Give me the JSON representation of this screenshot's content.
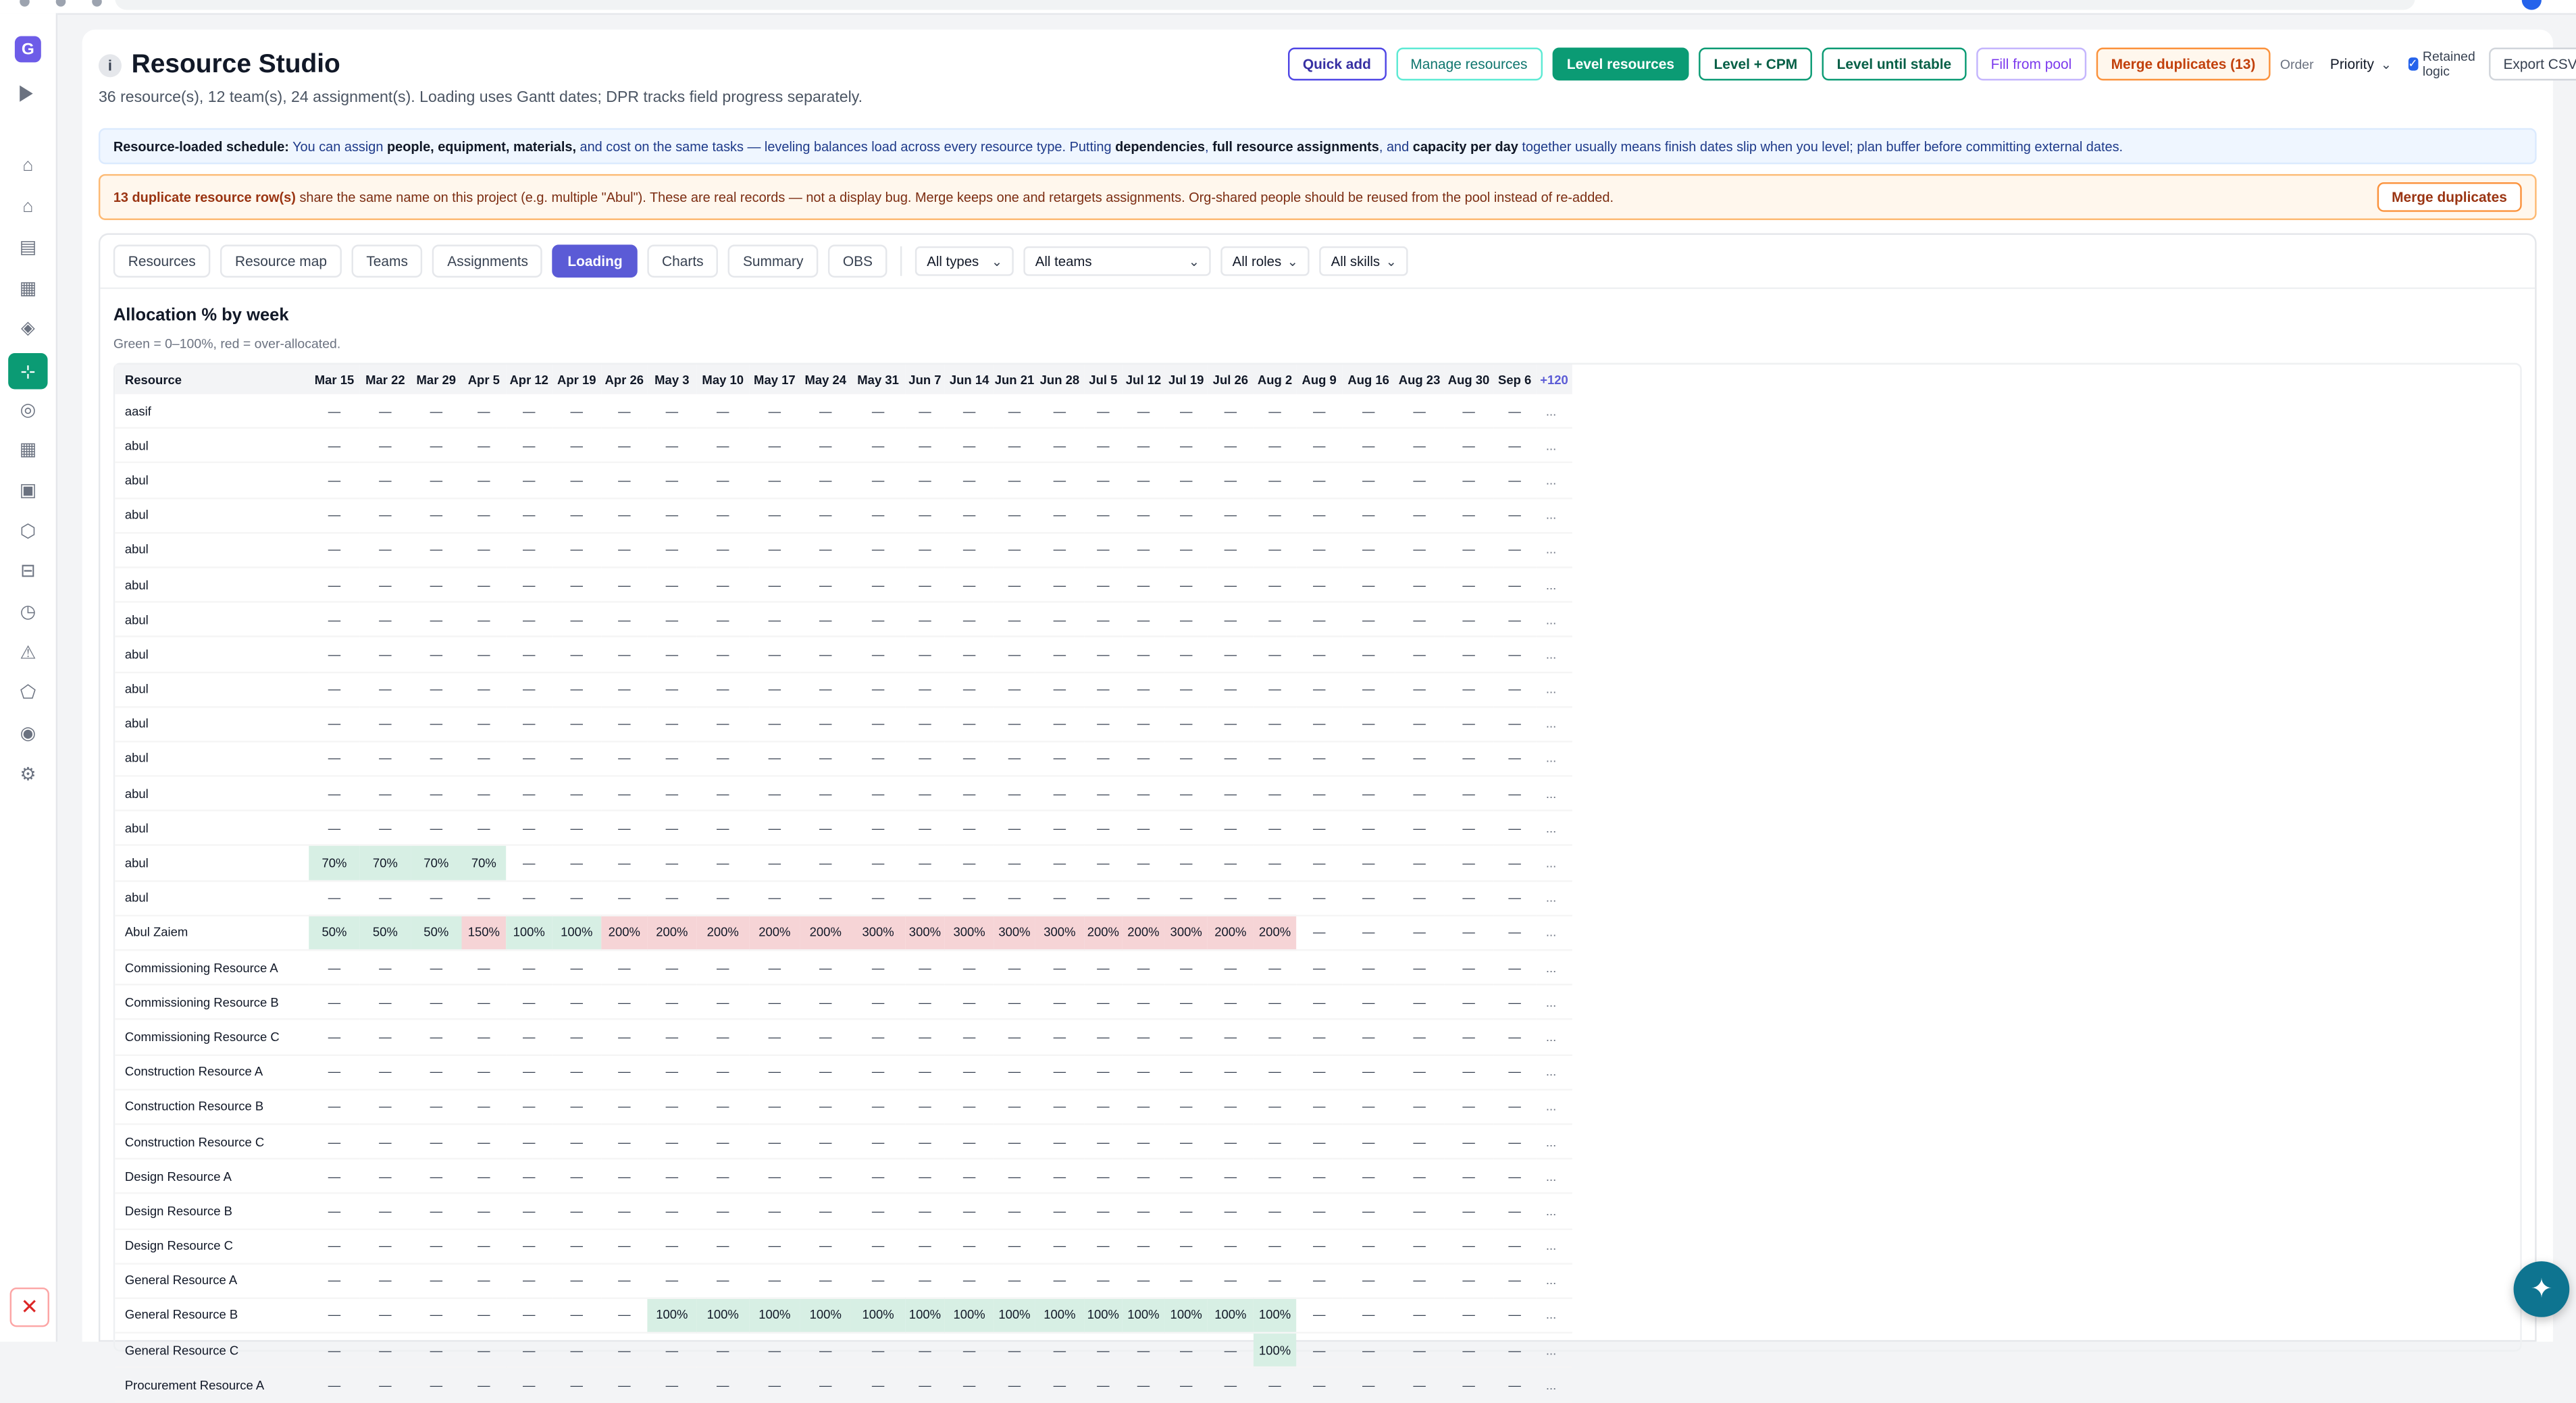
{
  "app": {
    "title": "Resource Studio",
    "info_glyph": "i",
    "subtitle": "36 resource(s), 12 team(s), 24 assignment(s). Loading uses Gantt dates; DPR tracks field progress separately.",
    "logo_letter": "G"
  },
  "toolbar": {
    "quick_add": "Quick add",
    "manage_resources": "Manage resources",
    "level_resources": "Level resources",
    "level_cpm": "Level + CPM",
    "level_until_stable": "Level until stable",
    "fill_from_pool": "Fill from pool",
    "merge_duplicates": "Merge duplicates (13)",
    "order_label": "Order",
    "order_value": "Priority",
    "retained_logic": "Retained logic",
    "retained_logic_checked": true,
    "export_csv": "Export CSV"
  },
  "banner_info": {
    "lead": "Resource-loaded schedule:",
    "t1": " You can assign ",
    "b1": "people, equipment, materials,",
    "t2": " and cost on the same tasks — leveling balances load across every resource type. Putting ",
    "b2": "dependencies",
    "t3": ", ",
    "b3": "full resource assignments",
    "t4": ", and ",
    "b4": "capacity per day",
    "t5": " together usually means finish dates slip when you level; plan buffer before committing external dates."
  },
  "banner_dup": {
    "lead": "13 duplicate resource row(s)",
    "text": " share the same name on this project (e.g. multiple \"Abul\"). These are real records — not a display bug. Merge keeps one and retargets assignments. Org-shared people should be reused from the pool instead of re-added.",
    "button": "Merge duplicates"
  },
  "tabs": [
    "Resources",
    "Resource map",
    "Teams",
    "Assignments",
    "Loading",
    "Charts",
    "Summary",
    "OBS"
  ],
  "active_tab": "Loading",
  "filters": {
    "types": "All types",
    "teams": "All teams",
    "roles": "All roles",
    "skills": "All skills"
  },
  "section": {
    "title": "Allocation % by week",
    "note": "Green = 0–100%, red = over-allocated."
  },
  "table": {
    "resource_header": "Resource",
    "weeks": [
      "Mar 15",
      "Mar 22",
      "Mar 29",
      "Apr 5",
      "Apr 12",
      "Apr 19",
      "Apr 26",
      "May 3",
      "May 10",
      "May 17",
      "May 24",
      "May 31",
      "Jun 7",
      "Jun 14",
      "Jun 21",
      "Jun 28",
      "Jul 5",
      "Jul 12",
      "Jul 19",
      "Jul 26",
      "Aug 2",
      "Aug 9",
      "Aug 16",
      "Aug 23",
      "Aug 30",
      "Sep 6"
    ],
    "more_header": "+120",
    "empty_glyph": "—",
    "more_glyph": "...",
    "rows": [
      {
        "name": "aasif",
        "cells": {}
      },
      {
        "name": "abul",
        "cells": {}
      },
      {
        "name": "abul",
        "cells": {}
      },
      {
        "name": "abul",
        "cells": {}
      },
      {
        "name": "abul",
        "cells": {}
      },
      {
        "name": "abul",
        "cells": {}
      },
      {
        "name": "abul",
        "cells": {}
      },
      {
        "name": "abul",
        "cells": {}
      },
      {
        "name": "abul",
        "cells": {}
      },
      {
        "name": "abul",
        "cells": {}
      },
      {
        "name": "abul",
        "cells": {}
      },
      {
        "name": "abul",
        "cells": {}
      },
      {
        "name": "abul",
        "cells": {}
      },
      {
        "name": "abul",
        "cells": {
          "0": 70,
          "1": 70,
          "2": 70,
          "3": 70
        }
      },
      {
        "name": "abul",
        "cells": {}
      },
      {
        "name": "Abul Zaiem",
        "cells": {
          "0": 50,
          "1": 50,
          "2": 50,
          "3": 150,
          "4": 100,
          "5": 100,
          "6": 200,
          "7": 200,
          "8": 200,
          "9": 200,
          "10": 200,
          "11": 300,
          "12": 300,
          "13": 300,
          "14": 300,
          "15": 300,
          "16": 200,
          "17": 200,
          "18": 300,
          "19": 200,
          "20": 200
        }
      },
      {
        "name": "Commissioning Resource A",
        "cells": {}
      },
      {
        "name": "Commissioning Resource B",
        "cells": {}
      },
      {
        "name": "Commissioning Resource C",
        "cells": {}
      },
      {
        "name": "Construction Resource A",
        "cells": {}
      },
      {
        "name": "Construction Resource B",
        "cells": {}
      },
      {
        "name": "Construction Resource C",
        "cells": {}
      },
      {
        "name": "Design Resource A",
        "cells": {}
      },
      {
        "name": "Design Resource B",
        "cells": {}
      },
      {
        "name": "Design Resource C",
        "cells": {}
      },
      {
        "name": "General Resource A",
        "cells": {}
      },
      {
        "name": "General Resource B",
        "cells": {
          "7": 100,
          "8": 100,
          "9": 100,
          "10": 100,
          "11": 100,
          "12": 100,
          "13": 100,
          "14": 100,
          "15": 100,
          "16": 100,
          "17": 100,
          "18": 100,
          "19": 100,
          "20": 100
        }
      },
      {
        "name": "General Resource C",
        "cells": {
          "20": 100
        }
      },
      {
        "name": "Procurement Resource A",
        "cells": {}
      }
    ]
  },
  "colors": {
    "accent_green": "#0b9b74",
    "accent_indigo": "#5b5bd6",
    "cell_ok": "#d7efe4",
    "cell_over": "#f6d4d6"
  },
  "rail_icons": [
    "home-icon",
    "house-icon",
    "list-icon",
    "grid-icon",
    "diamond-icon",
    "network-icon",
    "target-icon",
    "table-icon",
    "board-icon",
    "hexagon-icon",
    "layers-icon",
    "clock-icon",
    "warning-icon",
    "pentagon-icon",
    "radio-icon",
    "settings-icon"
  ],
  "rail_glyphs": [
    "⌂",
    "⌂",
    "▤",
    "▦",
    "◈",
    "⊹",
    "◎",
    "▦",
    "▣",
    "⬡",
    "⊟",
    "◷",
    "⚠",
    "⬠",
    "◉",
    "⚙"
  ],
  "rail_active_index": 5,
  "close_glyph": "✕",
  "fab_glyph": "✦"
}
